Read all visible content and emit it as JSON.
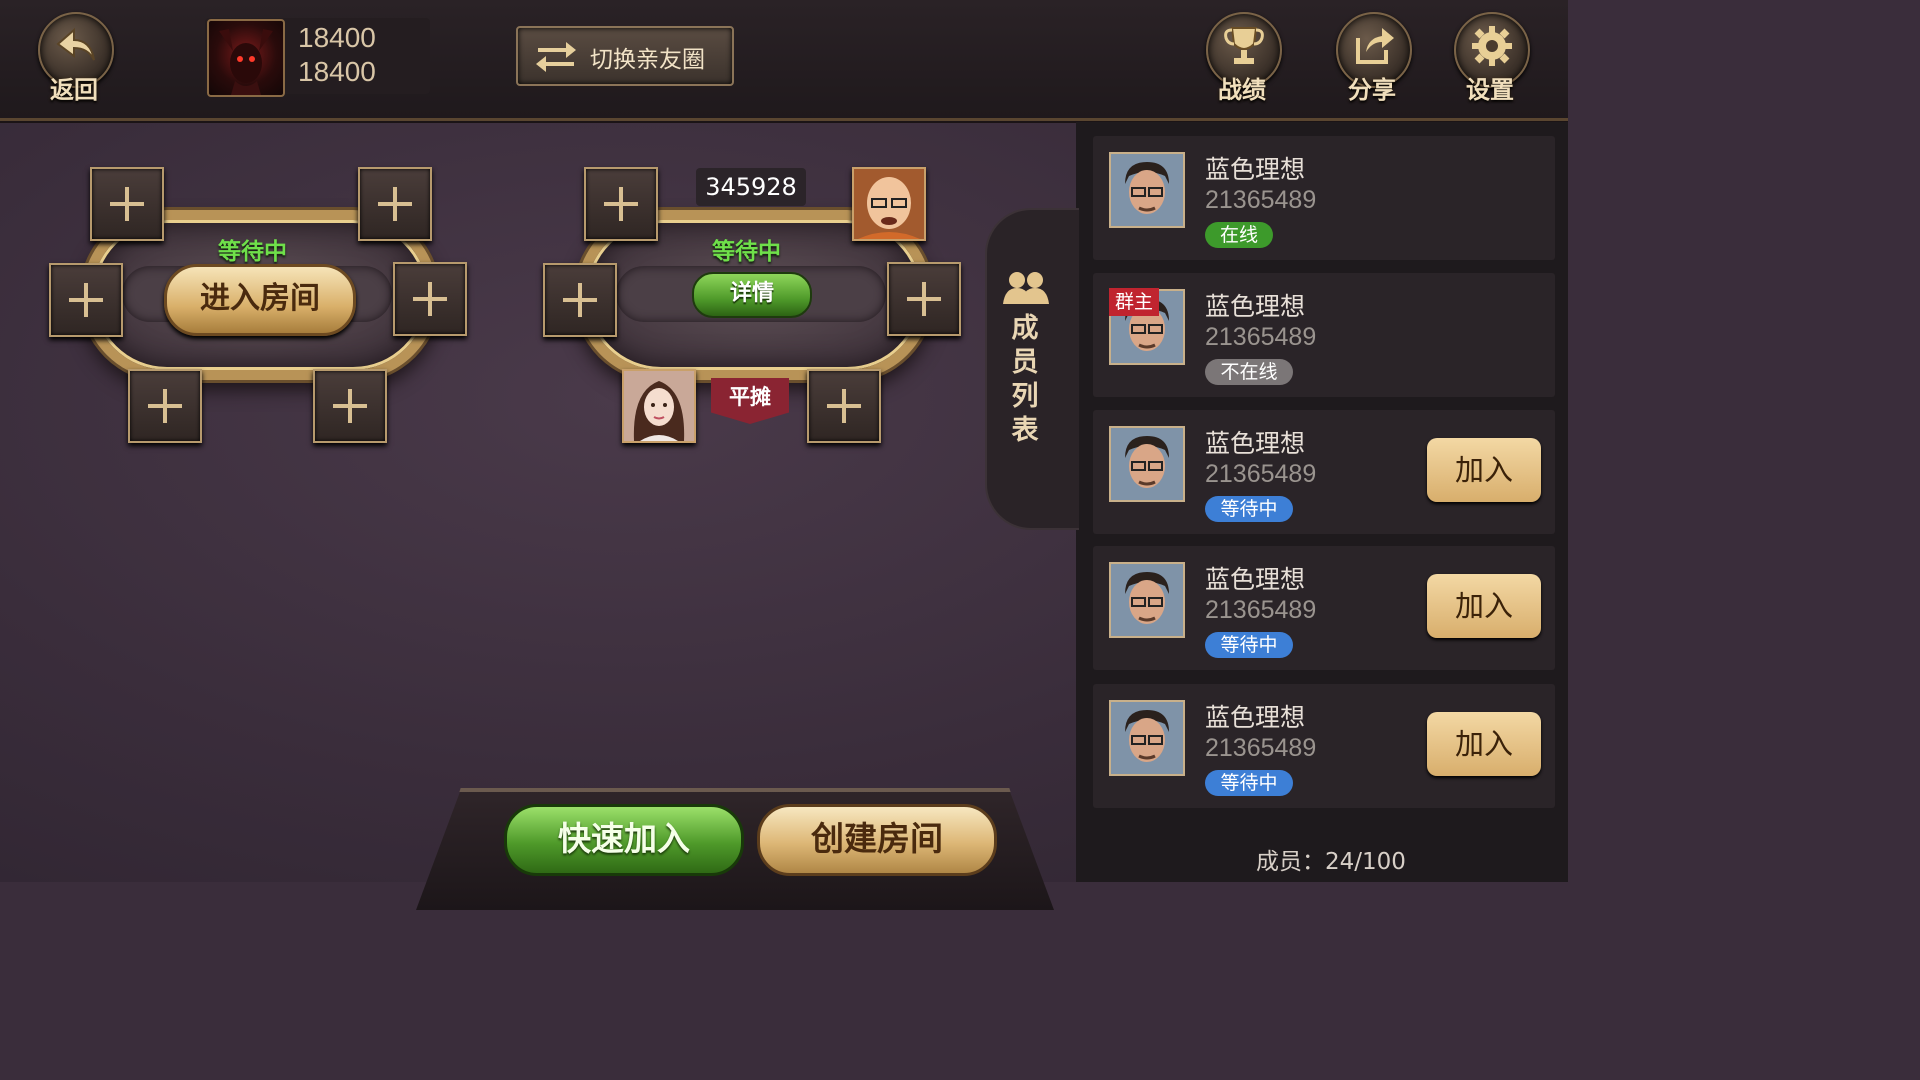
{
  "topbar": {
    "back_label": "返回",
    "balance_1": "18400",
    "balance_2": "18400",
    "switch_label": "切换亲友圈",
    "record_label": "战绩",
    "share_label": "分享",
    "settings_label": "设置"
  },
  "table1": {
    "status": "等待中",
    "enter_label": "进入房间"
  },
  "table2": {
    "room_number": "345928",
    "status": "等待中",
    "details_label": "详情",
    "split_label": "平摊"
  },
  "member_tab": {
    "label": "成员列表"
  },
  "members": [
    {
      "name": "蓝色理想",
      "id": "21365489",
      "status": "在线",
      "status_color": "#3d9a2b",
      "owner": "",
      "join_label": ""
    },
    {
      "name": "蓝色理想",
      "id": "21365489",
      "status": "不在线",
      "status_color": "#7b7677",
      "owner": "群主",
      "join_label": ""
    },
    {
      "name": "蓝色理想",
      "id": "21365489",
      "status": "等待中",
      "status_color": "#3d7fd6",
      "owner": "",
      "join_label": "加入"
    },
    {
      "name": "蓝色理想",
      "id": "21365489",
      "status": "等待中",
      "status_color": "#3d7fd6",
      "owner": "",
      "join_label": "加入"
    },
    {
      "name": "蓝色理想",
      "id": "21365489",
      "status": "等待中",
      "status_color": "#3d7fd6",
      "owner": "",
      "join_label": "加入"
    }
  ],
  "member_count": "成员：24/100",
  "bottom": {
    "quick_join_label": "快速加入",
    "create_room_label": "创建房间"
  },
  "colors": {
    "online": "#3d9a2b",
    "offline": "#7b7677",
    "waiting": "#3d7fd6",
    "owner_badge": "#c0242f"
  }
}
